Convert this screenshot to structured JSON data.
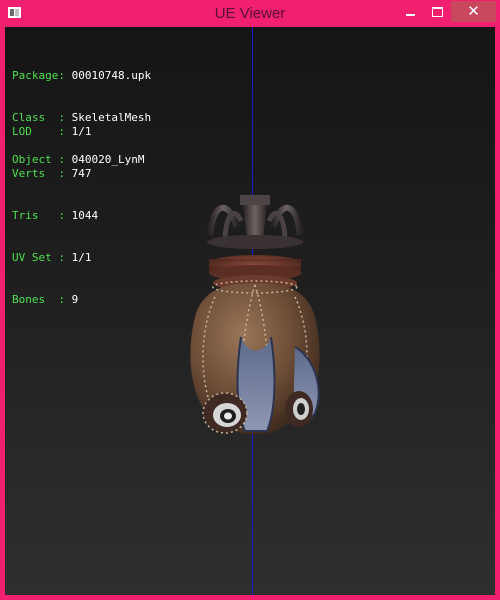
{
  "window": {
    "title": "UE Viewer",
    "close_glyph": "✕",
    "title_color": "#5a1030",
    "frame_color": "#f0206e"
  },
  "info_block_1": [
    {
      "label": "Package:",
      "value": "00010748.upk"
    },
    {
      "label": "Class  :",
      "value": "SkeletalMesh"
    },
    {
      "label": "Object :",
      "value": "040020_LynM"
    }
  ],
  "info_block_2": [
    {
      "label": "LOD    :",
      "value": "1/1"
    },
    {
      "label": "Verts  :",
      "value": "747"
    },
    {
      "label": "Tris   :",
      "value": "1044"
    },
    {
      "label": "UV Set :",
      "value": "1/1"
    },
    {
      "label": "Bones  :",
      "value": "9"
    }
  ],
  "colors": {
    "label": "#4ee04e",
    "value": "#ffffff",
    "axis": "#1a1acc"
  },
  "icons": {
    "app": "app-window-icon",
    "minimize": "minimize-icon",
    "maximize": "maximize-icon",
    "close": "close-icon"
  }
}
